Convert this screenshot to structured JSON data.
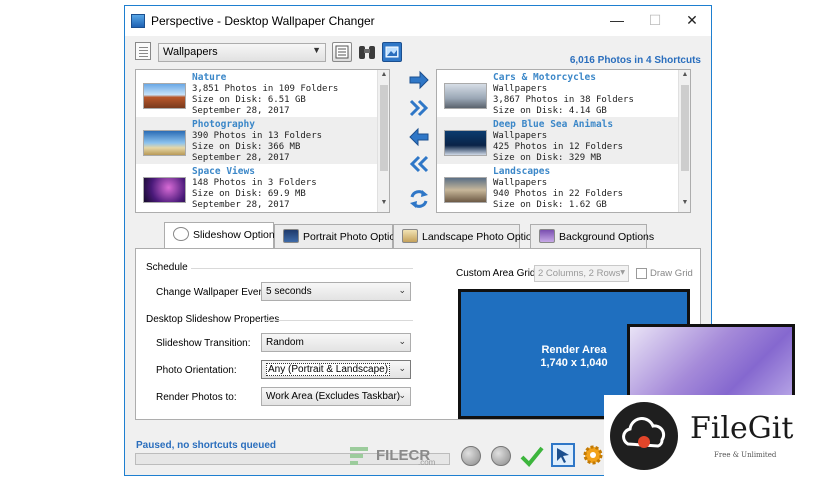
{
  "window": {
    "title": "Perspective - Desktop Wallpaper Changer",
    "controls": {
      "minimize": "—",
      "maximize": "☐",
      "close": "✕"
    }
  },
  "toolbar": {
    "category_value": "Wallpapers",
    "photo_count": "6,016 Photos in 4 Shortcuts",
    "icons": [
      "list-icon",
      "binoculars-icon",
      "picture-icon"
    ]
  },
  "left_list": [
    {
      "title": "Nature",
      "lines": [
        "3,851 Photos in 109 Folders",
        "Size on Disk: 6.51 GB",
        "September 28, 2017"
      ]
    },
    {
      "title": "Photography",
      "lines": [
        "390 Photos in 13 Folders",
        "Size on Disk: 366 MB",
        "September 28, 2017"
      ]
    },
    {
      "title": "Space Views",
      "lines": [
        "148 Photos in 3 Folders",
        "Size on Disk: 69.9 MB",
        "September 28, 2017"
      ]
    }
  ],
  "right_list": [
    {
      "title": "Cars & Motorcycles",
      "lines": [
        "Wallpapers",
        "3,867 Photos in 38 Folders",
        "Size on Disk: 4.14 GB"
      ]
    },
    {
      "title": "Deep Blue Sea Animals",
      "lines": [
        "Wallpapers",
        "425 Photos in 12 Folders",
        "Size on Disk: 329 MB"
      ]
    },
    {
      "title": "Landscapes",
      "lines": [
        "Wallpapers",
        "940 Photos in 22 Folders",
        "Size on Disk: 1.62 GB"
      ]
    }
  ],
  "tabs": [
    {
      "label": "Slideshow Options",
      "active": true
    },
    {
      "label": "Portrait Photo Options",
      "active": false
    },
    {
      "label": "Landscape Photo Options",
      "active": false
    },
    {
      "label": "Background Options",
      "active": false
    }
  ],
  "slideshow": {
    "schedule_label": "Schedule",
    "change_label": "Change Wallpaper Every:",
    "change_value": "5 seconds",
    "properties_label": "Desktop Slideshow Properties",
    "transition_label": "Slideshow Transition:",
    "transition_value": "Random",
    "orientation_label": "Photo Orientation:",
    "orientation_value": "Any (Portrait & Landscape)",
    "render_label": "Render Photos to:",
    "render_value": "Work Area (Excludes Taskbar)",
    "grid_label": "Custom Area Grid:",
    "grid_value": "2 Columns, 2 Rows",
    "draw_grid_label": "Draw Grid",
    "render_area_title": "Render Area",
    "render_area_size": "1,740 x 1,040"
  },
  "status": {
    "text": "Paused, no shortcuts queued"
  },
  "watermarks": {
    "filecr": "FILECR",
    "filecr_suffix": ".com",
    "filegit": "FileGit",
    "filegit_tag": "Free & Unlimited"
  },
  "colors": {
    "accent": "#2a6ebd",
    "item_title": "#3b87c8",
    "render_area": "#1f6fbf",
    "window_border": "#1e7fd0"
  }
}
